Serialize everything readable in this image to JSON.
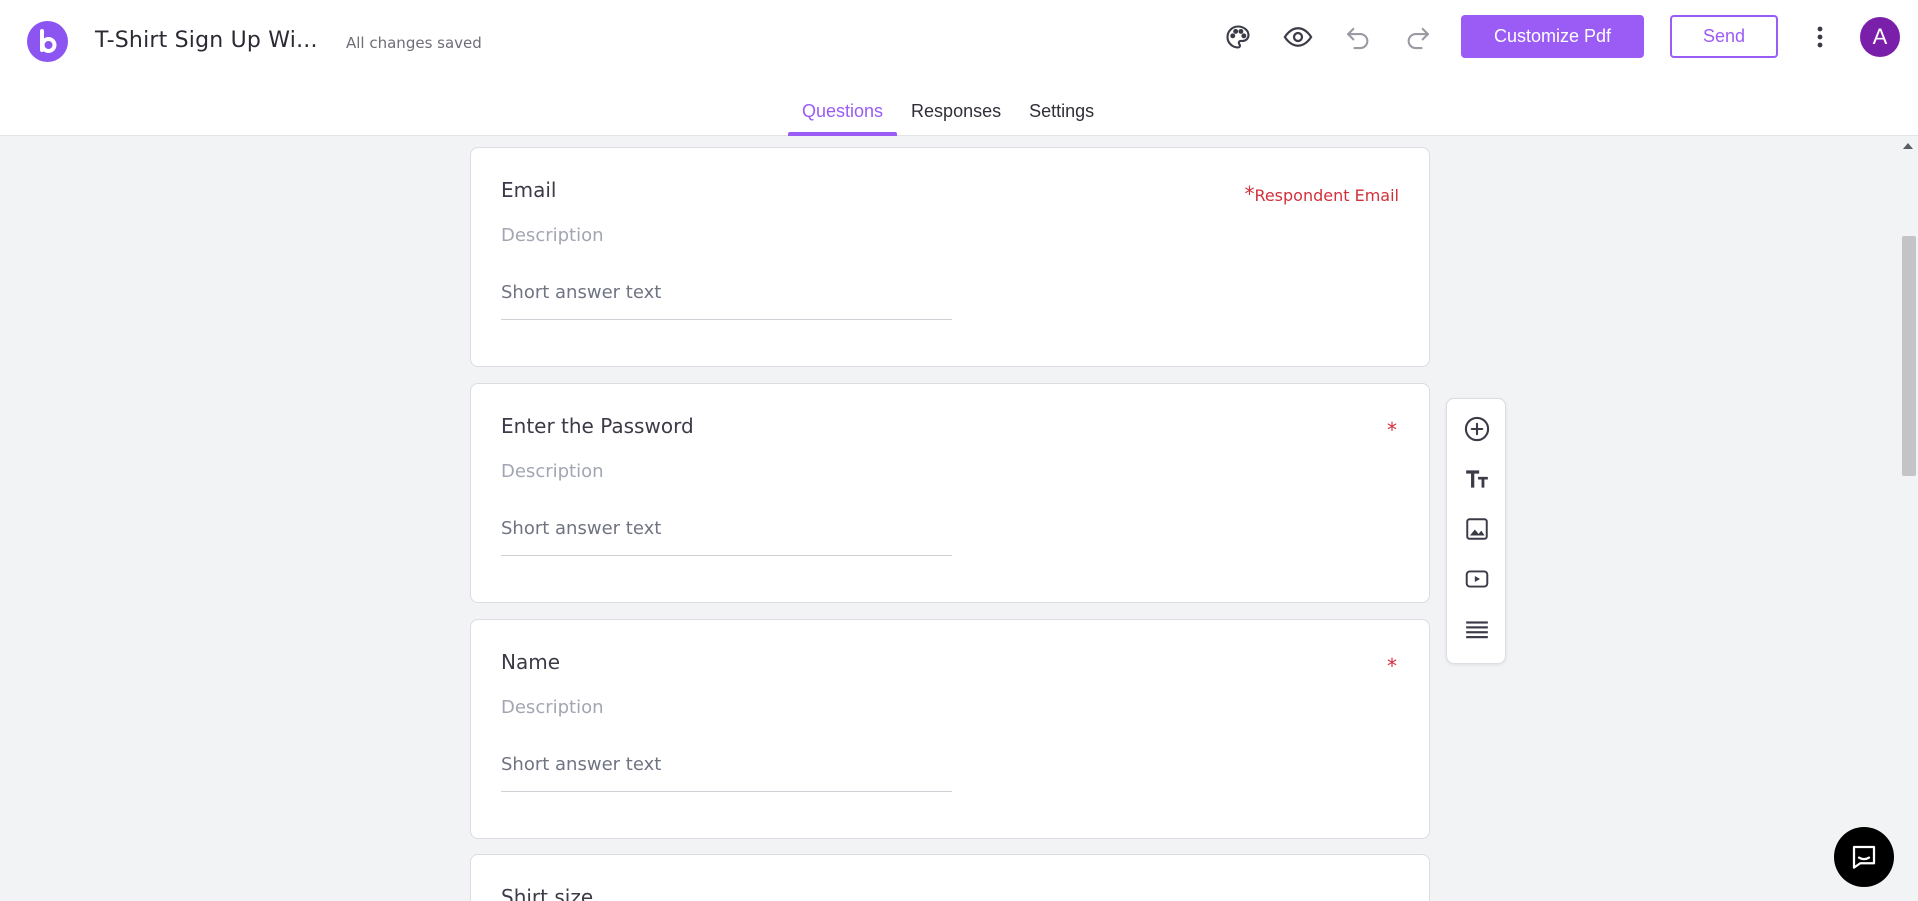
{
  "header": {
    "title": "T-Shirt Sign Up Wi...",
    "save_status": "All changes saved",
    "customize_label": "Customize Pdf",
    "send_label": "Send",
    "avatar_letter": "A"
  },
  "icons": {
    "logo": "brand-logo-icon",
    "palette": "palette-icon",
    "preview": "eye-icon",
    "undo": "undo-icon",
    "redo": "redo-icon",
    "more": "more-vertical-icon",
    "add": "add-circle-icon",
    "text": "title-text-icon",
    "image": "image-icon",
    "video": "video-icon",
    "section": "section-icon",
    "chat": "chat-icon"
  },
  "colors": {
    "accent": "#9a5cf5",
    "required": "#d2303a",
    "avatar": "#7a1fa9"
  },
  "tabs": [
    {
      "label": "Questions",
      "active": true
    },
    {
      "label": "Responses",
      "active": false
    },
    {
      "label": "Settings",
      "active": false
    }
  ],
  "questions": [
    {
      "title": "Email",
      "description": "Description",
      "answer_placeholder": "Short answer text",
      "required_label": "Respondent Email",
      "required_mark": "*"
    },
    {
      "title": "Enter the Password",
      "description": "Description",
      "answer_placeholder": "Short answer text",
      "required_mark": "*"
    },
    {
      "title": "Name",
      "description": "Description",
      "answer_placeholder": "Short answer text",
      "required_mark": "*"
    },
    {
      "title": "Shirt size"
    }
  ]
}
